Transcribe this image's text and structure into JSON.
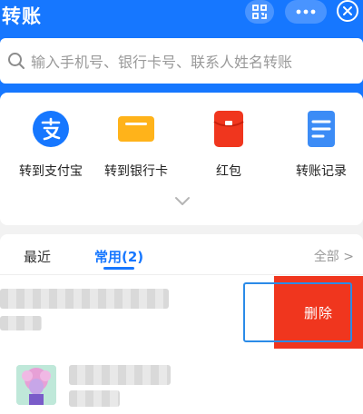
{
  "header": {
    "title": "转账"
  },
  "icons": {
    "scan": "scan-icon",
    "more": "more-icon",
    "close": "close-icon",
    "search": "search-icon"
  },
  "search": {
    "placeholder": "输入手机号、银行卡号、联系人姓名转账"
  },
  "quick_actions": [
    {
      "label": "转到支付宝",
      "icon": "alipay-icon",
      "color": "#1677ff"
    },
    {
      "label": "转到银行卡",
      "icon": "bank-card-icon",
      "color": "#ffb31a"
    },
    {
      "label": "红包",
      "icon": "red-packet-icon",
      "color": "#f0361e"
    },
    {
      "label": "转账记录",
      "icon": "transfer-record-icon",
      "color": "#3c8cf6"
    }
  ],
  "tabs": [
    {
      "label": "最近",
      "active": false
    },
    {
      "label": "常用(2)",
      "active": true
    }
  ],
  "all_link": "全部 >",
  "contact_actions": {
    "delete_label": "删除"
  },
  "colors": {
    "primary": "#1677ff",
    "delete": "#f0361e"
  }
}
